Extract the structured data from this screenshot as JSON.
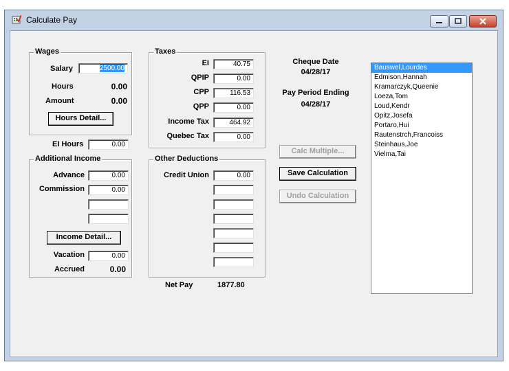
{
  "window": {
    "title": "Calculate Pay"
  },
  "wages": {
    "legend": "Wages",
    "salary_label": "Salary",
    "salary_value": "2500.00",
    "hours_label": "Hours",
    "hours_value": "0.00",
    "amount_label": "Amount",
    "amount_value": "0.00",
    "hours_detail_button": "Hours Detail..."
  },
  "ei_hours": {
    "label": "EI Hours",
    "value": "0.00"
  },
  "additional_income": {
    "legend": "Additional Income",
    "advance_label": "Advance",
    "advance_value": "0.00",
    "commission_label": "Commission",
    "commission_value": "0.00",
    "income_detail_button": "Income Detail...",
    "vacation_label": "Vacation",
    "vacation_value": "0.00",
    "accrued_label": "Accrued",
    "accrued_value": "0.00"
  },
  "taxes": {
    "legend": "Taxes",
    "ei_label": "EI",
    "ei_value": "40.75",
    "qpip_label": "QPIP",
    "qpip_value": "0.00",
    "cpp_label": "CPP",
    "cpp_value": "116.53",
    "qpp_label": "QPP",
    "qpp_value": "0.00",
    "income_tax_label": "Income Tax",
    "income_tax_value": "464.92",
    "quebec_tax_label": "Quebec Tax",
    "quebec_tax_value": "0.00"
  },
  "other_deductions": {
    "legend": "Other Deductions",
    "credit_union_label": "Credit Union",
    "credit_union_value": "0.00"
  },
  "net_pay": {
    "label": "Net Pay",
    "value": "1877.80"
  },
  "cheque": {
    "date_label": "Cheque Date",
    "date_value": "04/28/17",
    "period_label": "Pay Period Ending",
    "period_value": "04/28/17"
  },
  "buttons": {
    "calc_multiple": "Calc Multiple...",
    "save_calculation": "Save Calculation",
    "undo_calculation": "Undo Calculation"
  },
  "employees": [
    "Bauswel,Lourdes",
    "Edmison,Hannah",
    "Kramarczyk,Queenie",
    "Loeza,Tom",
    "Loud,Kendr",
    "Opitz,Josefa",
    "Portaro,Hui",
    "Rautenstrch,Francoiss",
    "Steinhaus,Joe",
    "Vielma,Tai"
  ],
  "selected_employee": "Bauswel,Lourdes"
}
